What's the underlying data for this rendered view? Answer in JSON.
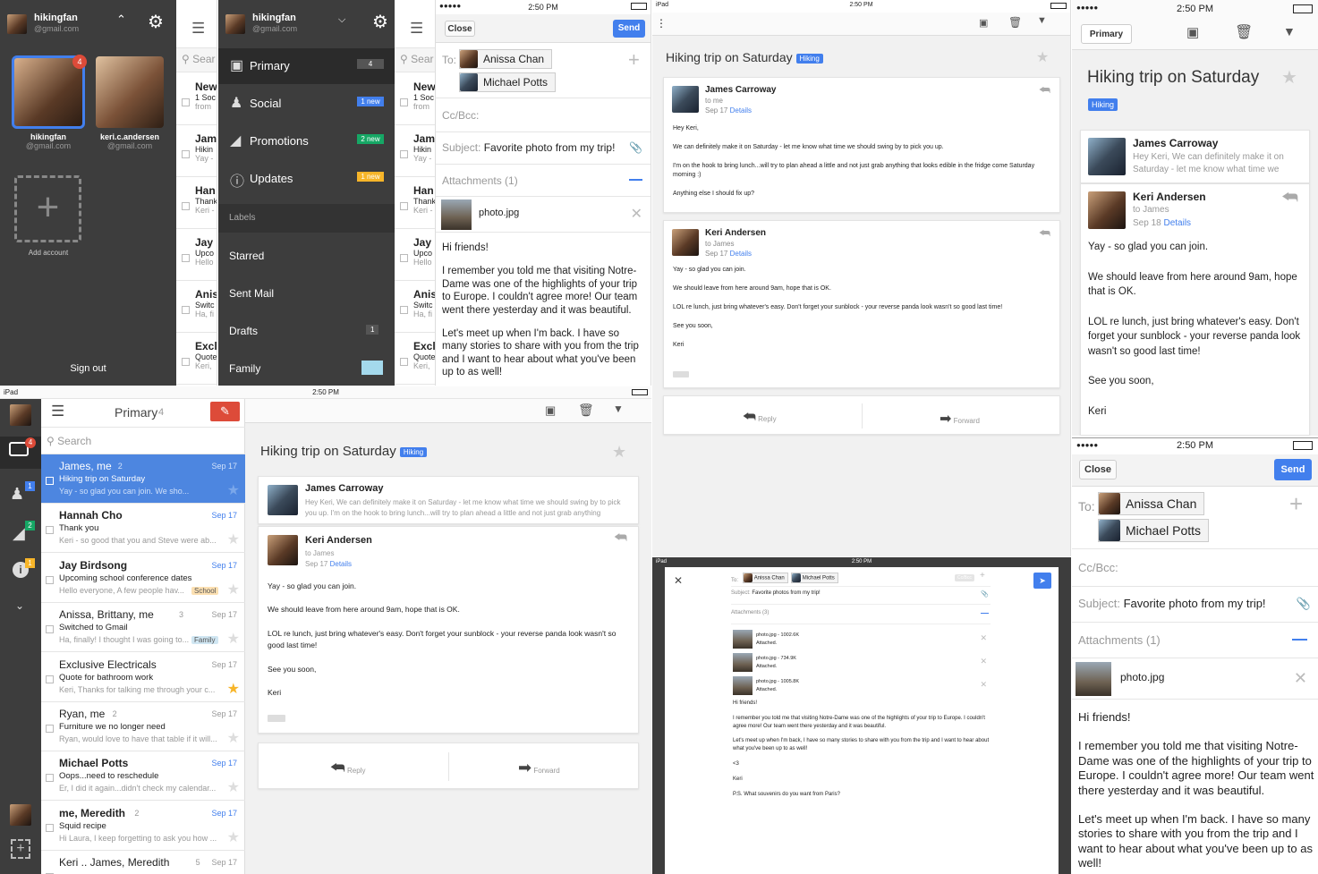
{
  "account": {
    "name": "hikingfan",
    "email": "@gmail.com",
    "second_name": "keri.c.andersen",
    "second_email": "@gmail.com",
    "badge": "4",
    "add_label": "Add account",
    "signout": "Sign out"
  },
  "nav": {
    "items": [
      {
        "label": "Primary",
        "count": "4"
      },
      {
        "label": "Social",
        "count": "1 new"
      },
      {
        "label": "Promotions",
        "count": "2 new"
      },
      {
        "label": "Updates",
        "count": "1 new"
      }
    ],
    "labels_header": "Labels",
    "labels": [
      {
        "label": "Starred",
        "count": ""
      },
      {
        "label": "Sent Mail",
        "count": ""
      },
      {
        "label": "Drafts",
        "count": "1"
      },
      {
        "label": "Family",
        "count": ""
      }
    ]
  },
  "peek_list": {
    "search": "Sear",
    "rows": [
      {
        "t1": "New",
        "t2": "1 Soc",
        "t3": "from"
      },
      {
        "t1": "Jam",
        "t2": "Hikin",
        "t3": "Yay -"
      },
      {
        "t1": "Han",
        "t2": "Thank",
        "t3": "Keri -"
      },
      {
        "t1": "Jay",
        "t2": "Upco",
        "t3": "Hello"
      },
      {
        "t1": "Anis",
        "t2": "Switc",
        "t3": "Ha, fi"
      },
      {
        "t1": "Excl",
        "t2": "Quote",
        "t3": "Keri,"
      }
    ]
  },
  "status": {
    "time": "2:50 PM",
    "ipad": "iPad"
  },
  "compose": {
    "close": "Close",
    "send": "Send",
    "to_label": "To:",
    "recipients": [
      "Anissa Chan",
      "Michael Potts"
    ],
    "ccbcc": "Cc/Bcc:",
    "subject_label": "Subject:",
    "subject": "Favorite photo from my trip!",
    "attachments": "Attachments (1)",
    "attachment_name": "photo.jpg",
    "body": [
      "Hi friends!",
      "I remember you told me that visiting Notre-Dame was one of the highlights of your trip to Europe. I couldn't agree more! Our team went there yesterday and it was beautiful.",
      "Let's meet up when I'm back. I have so many stories to share with you from the trip and I want to hear about what you've been up to as well!"
    ]
  },
  "thread": {
    "title": "Hiking trip on Saturday",
    "label": "Hiking",
    "messages": [
      {
        "from": "James Carroway",
        "to": "to me",
        "date": "Sep 17",
        "details": "Details",
        "body": [
          "Hey Keri,",
          "We can definitely make it on Saturday - let me know what time we should swing by to pick you up.",
          "I'm on the hook to bring lunch...will try to plan ahead a little and not just grab anything that looks edible in the fridge come Saturday morning :)",
          "Anything else I should fix up?"
        ],
        "snippet": "Hey Keri, We can definitely make it on Saturday - let me know what time we should swing by to pick you up. I'm on the hook to bring lunch...will try to plan ahead a little and not just grab anything"
      },
      {
        "from": "Keri Andersen",
        "to": "to James",
        "date": "Sep 17",
        "date_phone": "Sep 18",
        "details": "Details",
        "body": [
          "Yay - so glad you can join.",
          "We should leave from here around 9am, hope that is OK.",
          "LOL re lunch, just bring whatever's easy. Don't forget your sunblock - your reverse panda look wasn't so good last time!",
          "See you soon,",
          "Keri"
        ]
      }
    ],
    "reply": "Reply",
    "forward": "Forward",
    "primary_btn": "Primary"
  },
  "inbox": {
    "title": "Primary",
    "count": "4",
    "search": "Search",
    "rows": [
      {
        "from": "James, me",
        "n": "2",
        "date": "Sep 17",
        "subject": "Hiking trip on Saturday",
        "snippet": "Yay - so glad you can join. We sho...",
        "label": "",
        "unread": false,
        "selected": true,
        "starred": false
      },
      {
        "from": "Hannah Cho",
        "n": "",
        "date": "Sep 17",
        "subject": "Thank you",
        "snippet": "Keri - so good that you and Steve were ab...",
        "label": "",
        "unread": true,
        "starred": false
      },
      {
        "from": "Jay Birdsong",
        "n": "",
        "date": "Sep 17",
        "subject": "Upcoming school conference dates",
        "snippet": "Hello everyone, A few people hav...",
        "label": "School",
        "unread": true,
        "starred": false
      },
      {
        "from": "Anissa, Brittany, me",
        "n": "3",
        "date": "Sep 17",
        "subject": "Switched to Gmail",
        "snippet": "Ha, finally! I thought I was going to...",
        "label": "Family",
        "unread": false,
        "starred": false
      },
      {
        "from": "Exclusive Electricals",
        "n": "",
        "date": "Sep 17",
        "subject": "Quote for bathroom work",
        "snippet": "Keri, Thanks for talking me through your c...",
        "label": "",
        "unread": false,
        "starred": true
      },
      {
        "from": "Ryan, me",
        "n": "2",
        "date": "Sep 17",
        "subject": "Furniture we no longer need",
        "snippet": "Ryan, would love to have that table if it will...",
        "label": "",
        "unread": false,
        "starred": false
      },
      {
        "from": "Michael Potts",
        "n": "",
        "date": "Sep 17",
        "subject": "Oops...need to reschedule",
        "snippet": "Er, I did it again...didn't check my calendar...",
        "label": "",
        "unread": true,
        "starred": false
      },
      {
        "from": "me, Meredith",
        "n": "2",
        "date": "Sep 17",
        "subject": "Squid recipe",
        "snippet": "Hi Laura, I keep forgetting to ask you how ...",
        "label": "",
        "unread": true,
        "starred": false
      },
      {
        "from": "Keri .. James, Meredith",
        "n": "5",
        "date": "Sep 17",
        "subject": "",
        "snippet": "",
        "label": "",
        "unread": false,
        "starred": false
      }
    ]
  },
  "rail": {
    "badges": [
      "4",
      "1",
      "2",
      "1"
    ]
  },
  "compose_ipad": {
    "to_label": "To:",
    "recipients": [
      "Anissa Chan",
      "Michael Potts"
    ],
    "ccbcc": "Cc/Bcc",
    "subject_label": "Subject:",
    "subject": "Favorite photos from my trip!",
    "attachments": "Attachments (3)",
    "files": [
      {
        "name": "photo.jpg - 1002.6K",
        "status": "Attached."
      },
      {
        "name": "photo.jpg - 734.9K",
        "status": "Attached."
      },
      {
        "name": "photo.jpg - 1005.8K",
        "status": "Attached."
      }
    ],
    "body": [
      "Hi friends!",
      "I remember you told me that visiting Notre-Dame was one of the highlights of your trip to Europe. I couldn't agree more! Our team went there yesterday and it was beautiful.",
      "Let's meet up when I'm back, I have so many stories to share with you from the trip and I want to hear about what you've been up to as well!",
      "<3",
      "Keri",
      "P.S. What souvenirs do you want from Paris?"
    ]
  },
  "colors": {
    "accent": "#427fed",
    "compose_red": "#dd4b39",
    "dark": "#3d3d3d",
    "social": "#427fed",
    "promo": "#16a765",
    "updates": "#f7b529"
  }
}
